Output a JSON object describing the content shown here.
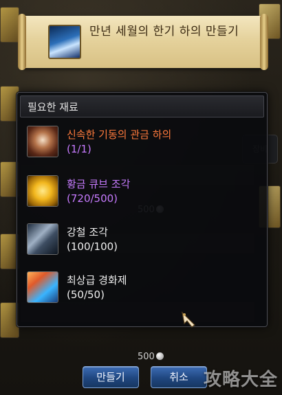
{
  "banner": {
    "title": "만년 세월의 한기 하의 만들기",
    "icon": "frost-legs-icon"
  },
  "popup": {
    "header": "필요한 재료",
    "materials": [
      {
        "name": "신속한 기동의 관금 하의",
        "count": "(1/1)",
        "icon": "armor-legs-icon",
        "name_color": "#ff7a3c"
      },
      {
        "name": "황금 큐브 조각",
        "count": "(720/500)",
        "icon": "golden-cube-icon",
        "name_color": "#c77bff"
      },
      {
        "name": "강철 조각",
        "count": "(100/100)",
        "icon": "steel-piece-icon",
        "name_color": "#f0f0f0"
      },
      {
        "name": "최상급 경화제",
        "count": "(50/50)",
        "icon": "hardener-icon",
        "name_color": "#f0f0f0"
      }
    ],
    "count_color": "#c77bff"
  },
  "background": {
    "gold_1": "500",
    "gold_2": "500",
    "side_button": "장비"
  },
  "buttons": {
    "make": "만들기",
    "cancel": "취소"
  },
  "watermark": "攻略大全"
}
